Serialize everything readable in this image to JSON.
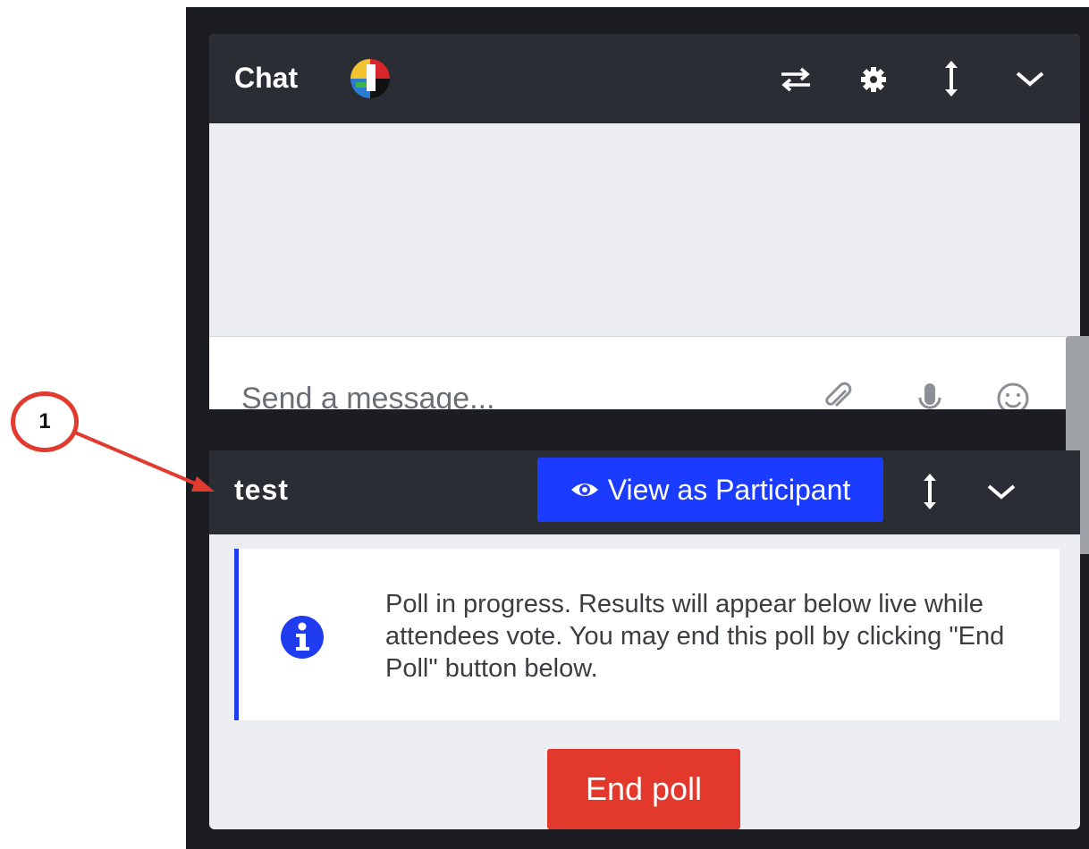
{
  "chat": {
    "title": "Chat",
    "input_placeholder": "Send a message...",
    "icons": [
      "swap-icon",
      "gear-icon",
      "resize-vertical-icon",
      "chevron-down-icon"
    ],
    "input_icons": [
      "paperclip-icon",
      "microphone-icon",
      "emoji-icon"
    ]
  },
  "poll": {
    "title": "test",
    "view_as_participant_label": "View as Participant",
    "info_text": "Poll in progress. Results will appear below live while attendees vote. You may end this poll by clicking \"End Poll\" button below.",
    "end_poll_label": "End poll"
  },
  "annotation": {
    "number": "1"
  },
  "colors": {
    "header_bg": "#2a2d34",
    "frame_bg": "#1b1d22",
    "primary_blue": "#1b3cff",
    "danger_red": "#e3382c",
    "annotation_red": "#e03b2e"
  }
}
